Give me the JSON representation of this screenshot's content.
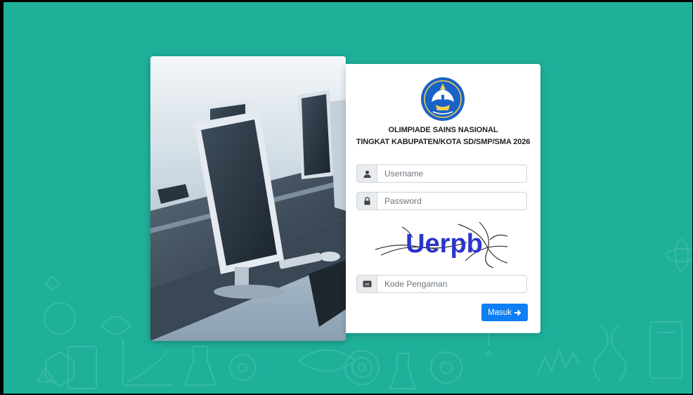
{
  "app": {
    "title_line1": "OLIMPIADE SAINS NASIONAL",
    "title_line2": "TINGKAT KABUPATEN/KOTA SD/SMP/SMA 2026",
    "logo_text": "TUT WURI HANDAYANI"
  },
  "form": {
    "username_placeholder": "Username",
    "password_placeholder": "Password",
    "captcha_text": "Uerpb",
    "code_placeholder": "Kode Pengaman",
    "submit_label": "Masuk"
  },
  "icons": {
    "username": "user-icon",
    "password": "lock-icon",
    "code": "cc-icon",
    "submit": "arrow-right-icon"
  },
  "colors": {
    "background": "#1fb09a",
    "button": "#0d7ef4",
    "logo": "#1a62c7"
  }
}
